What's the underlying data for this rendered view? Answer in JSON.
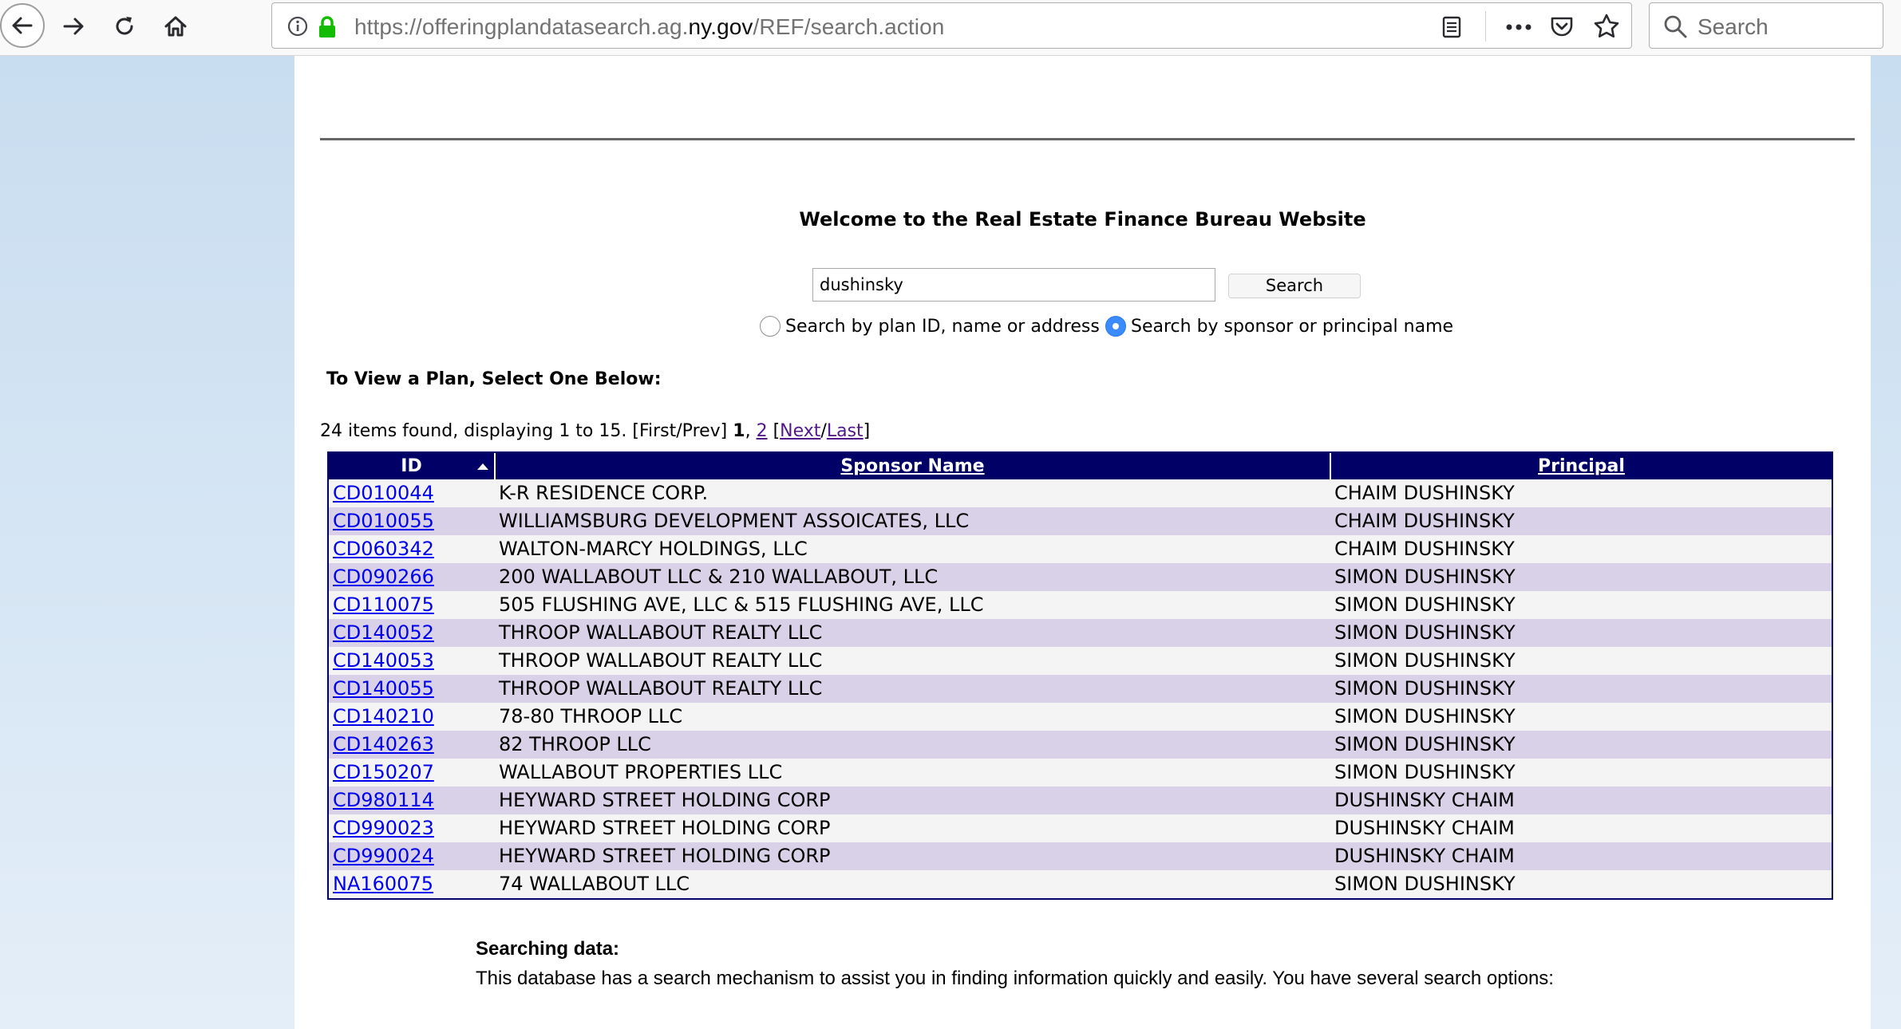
{
  "browser": {
    "url_prefix": "https://offeringplandatasearch.ag.",
    "url_domain": "ny.gov",
    "url_suffix": "/REF/search.action",
    "search_placeholder": "Search"
  },
  "page": {
    "welcome": "Welcome to the Real Estate Finance Bureau Website",
    "search_value": "dushinsky",
    "search_button": "Search",
    "radio_plan": "Search by plan ID, name or address",
    "radio_sponsor": "Search by sponsor or principal name",
    "radio_selected": "sponsor",
    "view_label": "To View a Plan, Select One Below:",
    "paging": {
      "summary": "24 items found, displaying 1 to 15.",
      "first_prev": "[First/Prev]",
      "current_page": "1",
      "page_2": "2",
      "next": "Next",
      "last": "Last"
    },
    "searching_title": "Searching data:",
    "searching_text": "This database has a search mechanism to assist you in finding information quickly and easily. You have several search options:"
  },
  "table": {
    "headers": {
      "id": "ID",
      "sponsor": "Sponsor Name",
      "principal": "Principal"
    },
    "rows": [
      {
        "id": "CD010044",
        "sponsor": "K-R RESIDENCE CORP.",
        "principal": "CHAIM DUSHINSKY"
      },
      {
        "id": "CD010055",
        "sponsor": "WILLIAMSBURG DEVELOPMENT ASSOICATES, LLC",
        "principal": "CHAIM DUSHINSKY"
      },
      {
        "id": "CD060342",
        "sponsor": "WALTON-MARCY HOLDINGS, LLC",
        "principal": "CHAIM DUSHINSKY"
      },
      {
        "id": "CD090266",
        "sponsor": "200 WALLABOUT LLC & 210 WALLABOUT, LLC",
        "principal": "SIMON DUSHINSKY"
      },
      {
        "id": "CD110075",
        "sponsor": "505 FLUSHING AVE, LLC & 515 FLUSHING AVE, LLC",
        "principal": "SIMON DUSHINSKY"
      },
      {
        "id": "CD140052",
        "sponsor": "THROOP WALLABOUT REALTY LLC",
        "principal": "SIMON DUSHINSKY"
      },
      {
        "id": "CD140053",
        "sponsor": "THROOP WALLABOUT REALTY LLC",
        "principal": "SIMON DUSHINSKY"
      },
      {
        "id": "CD140055",
        "sponsor": "THROOP WALLABOUT REALTY LLC",
        "principal": "SIMON DUSHINSKY"
      },
      {
        "id": "CD140210",
        "sponsor": "78-80 THROOP LLC",
        "principal": "SIMON DUSHINSKY"
      },
      {
        "id": "CD140263",
        "sponsor": "82 THROOP LLC",
        "principal": "SIMON DUSHINSKY"
      },
      {
        "id": "CD150207",
        "sponsor": "WALLABOUT PROPERTIES LLC",
        "principal": "SIMON DUSHINSKY"
      },
      {
        "id": "CD980114",
        "sponsor": "HEYWARD STREET HOLDING CORP",
        "principal": "DUSHINSKY CHAIM"
      },
      {
        "id": "CD990023",
        "sponsor": "HEYWARD STREET HOLDING CORP",
        "principal": "DUSHINSKY CHAIM"
      },
      {
        "id": "CD990024",
        "sponsor": "HEYWARD STREET HOLDING CORP",
        "principal": "DUSHINSKY CHAIM"
      },
      {
        "id": "NA160075",
        "sponsor": "74 WALLABOUT LLC",
        "principal": "SIMON DUSHINSKY"
      }
    ]
  },
  "icons": [
    "back-arrow-icon",
    "forward-arrow-icon",
    "reload-icon",
    "home-icon",
    "info-icon",
    "lock-icon",
    "reader-view-icon",
    "more-actions-icon",
    "pocket-icon",
    "star-icon",
    "search-icon"
  ]
}
